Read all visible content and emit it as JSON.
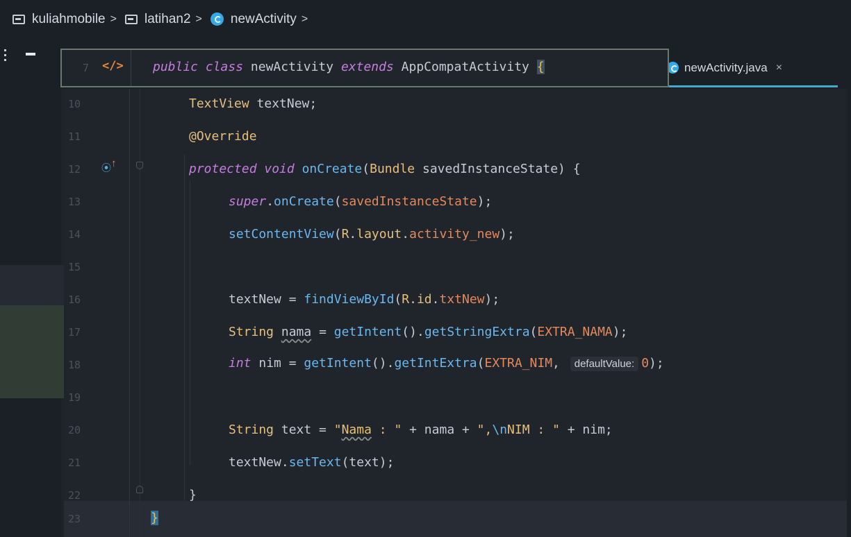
{
  "breadcrumb": {
    "items": [
      "kuliahmobile",
      "latihan2",
      "newActivity"
    ],
    "separator": ">"
  },
  "tab": {
    "label": "newActivity.java",
    "close": "×"
  },
  "sticky": {
    "line_number": "7",
    "icon": "xml-icon",
    "kw1": "public class",
    "name": "newActivity",
    "kw2": "extends",
    "type": "AppCompatActivity",
    "brace": "{"
  },
  "code": {
    "line_numbers": [
      "10",
      "11",
      "12",
      "13",
      "14",
      "15",
      "16",
      "17",
      "18",
      "19",
      "20",
      "21",
      "22",
      "23"
    ],
    "l10": {
      "type": "TextView",
      "rest": " textNew;"
    },
    "l11": {
      "annotation": "@Override"
    },
    "l12": {
      "kw": "protected void",
      "fn": "onCreate",
      "p1": "(",
      "type": "Bundle",
      "rest": " savedInstanceState) {"
    },
    "l13": {
      "kw": "super",
      "dot": ".",
      "fn": "onCreate",
      "p1": "(",
      "arg": "savedInstanceState",
      "p2": ");"
    },
    "l14": {
      "fn": "setContentView",
      "p1": "(",
      "r": "R",
      "dot1": ".",
      "layout": "layout",
      "dot2": ".",
      "field": "activity_new",
      "p2": ");"
    },
    "l16": {
      "var": "textNew",
      "eq": " = ",
      "fn": "findViewById",
      "p1": "(",
      "r": "R",
      "dot1": ".",
      "id": "id",
      "dot2": ".",
      "field": "txtNew",
      "p2": ");"
    },
    "l17": {
      "type": "String",
      "sp": " ",
      "var": "nama",
      "eq": " = ",
      "fn1": "getIntent",
      "p1": "().",
      "fn2": "getStringExtra",
      "p2": "(",
      "const": "EXTRA_NAMA",
      "p3": ");"
    },
    "l18": {
      "kw": "int",
      "rest": " nim = ",
      "fn1": "getIntent",
      "p1": "().",
      "fn2": "getIntExtra",
      "p2": "(",
      "const": "EXTRA_NIM",
      "comma": ", ",
      "hint": "defaultValue:",
      "num": "0",
      "p3": ");"
    },
    "l20": {
      "type": "String",
      "rest": " text = ",
      "s1a": "\"",
      "s1b": "Nama",
      "s1c": " : \"",
      "mid": " + nama + ",
      "s2a": "\",",
      "esc": "\\n",
      "s2b": "NIM : \"",
      "end": " + nim;"
    },
    "l21": {
      "var": "textNew",
      "dot": ".",
      "fn": "setText",
      "rest": "(text);"
    },
    "l22": {
      "brace": "}"
    },
    "l23": {
      "brace": "}"
    }
  }
}
